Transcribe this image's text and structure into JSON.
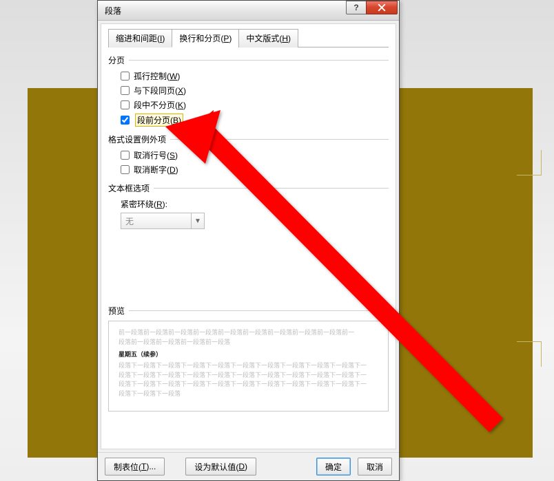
{
  "dialog": {
    "title": "段落",
    "help_symbol": "?",
    "tabs": [
      {
        "label": "缩进和间距(",
        "hot": "I",
        "tail": ")"
      },
      {
        "label": "换行和分页(",
        "hot": "P",
        "tail": ")"
      },
      {
        "label": "中文版式(",
        "hot": "H",
        "tail": ")"
      }
    ]
  },
  "groups": {
    "page": {
      "title": "分页",
      "opts": [
        {
          "label": "孤行控制(",
          "hot": "W",
          "tail": ")",
          "checked": false
        },
        {
          "label": "与下段同页(",
          "hot": "X",
          "tail": ")",
          "checked": false
        },
        {
          "label": "段中不分页(",
          "hot": "K",
          "tail": ")",
          "checked": false
        },
        {
          "label": "段前分页(",
          "hot": "B",
          "tail": ")",
          "checked": true
        }
      ]
    },
    "format": {
      "title": "格式设置例外项",
      "opts": [
        {
          "label": "取消行号(",
          "hot": "S",
          "tail": ")",
          "checked": false
        },
        {
          "label": "取消断字(",
          "hot": "D",
          "tail": ")",
          "checked": false
        }
      ]
    },
    "textbox": {
      "title": "文本框选项",
      "field_label_pre": "紧密环绕(",
      "field_hot": "R",
      "field_label_post": "):",
      "combo_value": "无"
    },
    "preview": {
      "title": "预览",
      "grey1": "前一段落前一段落前一段落前一段落前一段落前一段落前一段落前一段落前一段落前一",
      "grey2": "段落前一段落前一段落前一段落前一段落",
      "bold": "星期五（续参）",
      "grey3": "段落下一段落下一段落下一段落下一段落下一段落下一段落下一段落下一段落下一段落下一",
      "grey4": "段落下一段落下一段落下一段落下一段落下一段落下一段落下一段落下一段落下一段落下一",
      "grey5": "段落下一段落下一段落下一段落下一段落下一段落下一段落下一段落下一段落下一段落下一",
      "grey6": "段落下一段落下一段落"
    }
  },
  "buttons": {
    "tabs_btn_pre": "制表位(",
    "tabs_btn_hot": "T",
    "tabs_btn_post": ")...",
    "default_pre": "设为默认值(",
    "default_hot": "D",
    "default_post": ")",
    "ok": "确定",
    "cancel": "取消"
  }
}
